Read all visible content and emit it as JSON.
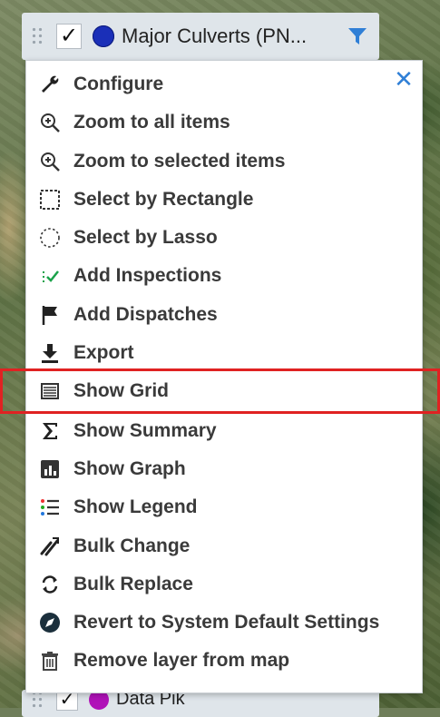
{
  "layer": {
    "name": "Major Culverts (PN...",
    "checked": "✓",
    "dot_color": "#1a2fb8"
  },
  "next_layer": {
    "name": "Data Pik",
    "checked": "✓",
    "dot_color": "#b012b8"
  },
  "menu": {
    "close_label": "✕",
    "items": [
      {
        "label": "Configure",
        "icon": "wrench-icon"
      },
      {
        "label": "Zoom to all items",
        "icon": "zoom-in-icon"
      },
      {
        "label": "Zoom to selected items",
        "icon": "zoom-in-icon"
      },
      {
        "label": "Select by Rectangle",
        "icon": "dashed-rectangle-icon"
      },
      {
        "label": "Select by Lasso",
        "icon": "dashed-lasso-icon"
      },
      {
        "label": "Add Inspections",
        "icon": "inspection-check-icon"
      },
      {
        "label": "Add Dispatches",
        "icon": "flag-icon"
      },
      {
        "label": "Export",
        "icon": "download-arrow-icon"
      },
      {
        "label": "Show Grid",
        "icon": "grid-table-icon"
      },
      {
        "label": "Show Summary",
        "icon": "sigma-icon"
      },
      {
        "label": "Show Graph",
        "icon": "bar-chart-icon"
      },
      {
        "label": "Show Legend",
        "icon": "legend-list-icon"
      },
      {
        "label": "Bulk Change",
        "icon": "bulk-change-icon"
      },
      {
        "label": "Bulk Replace",
        "icon": "bulk-replace-icon"
      },
      {
        "label": "Revert to System Default Settings",
        "icon": "revert-compass-icon"
      },
      {
        "label": "Remove layer from map",
        "icon": "trash-icon"
      }
    ]
  },
  "colors": {
    "accent": "#2f7fd6",
    "highlight_border": "#e02222",
    "menu_text": "#3a3a3a"
  }
}
